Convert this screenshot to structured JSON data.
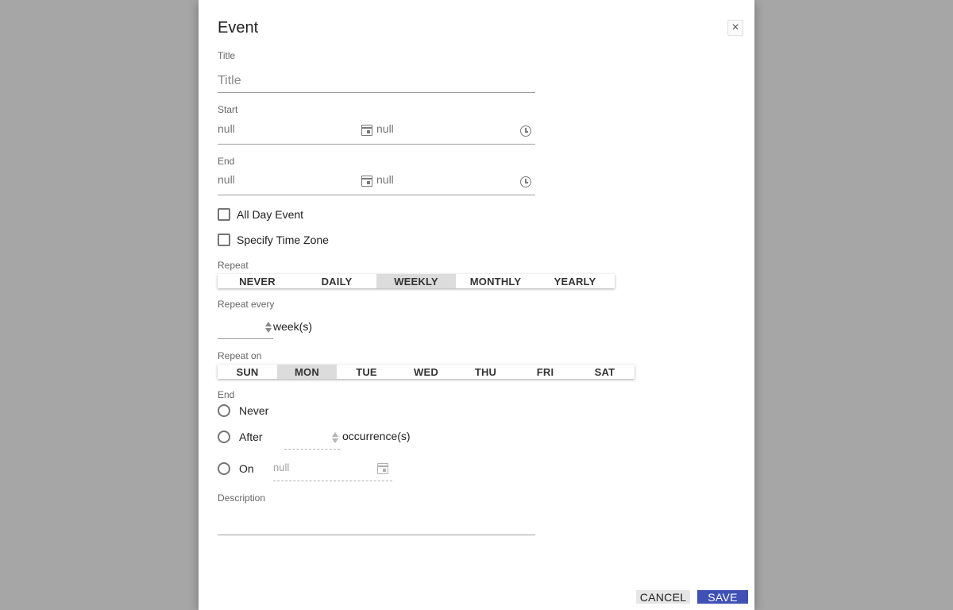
{
  "dialog": {
    "title": "Event",
    "close_glyph": "×"
  },
  "fields": {
    "title_label": "Title",
    "title_placeholder": "Title",
    "start_label": "Start",
    "start_date": "null",
    "start_time": "null",
    "end_label": "End",
    "end_date": "null",
    "end_time": "null",
    "all_day_label": "All Day Event",
    "time_zone_label": "Specify Time Zone"
  },
  "repeat": {
    "label": "Repeat",
    "options": [
      "NEVER",
      "DAILY",
      "WEEKLY",
      "MONTHLY",
      "YEARLY"
    ],
    "selected": "WEEKLY",
    "every_label": "Repeat every",
    "every_unit": "week(s)",
    "on_label": "Repeat on",
    "days": [
      "SUN",
      "MON",
      "TUE",
      "WED",
      "THU",
      "FRI",
      "SAT"
    ],
    "selected_day": "MON"
  },
  "end_options": {
    "label": "End",
    "never_label": "Never",
    "after_label": "After",
    "after_unit": "occurrence(s)",
    "on_label": "On",
    "on_date": "null"
  },
  "description": {
    "label": "Description"
  },
  "actions": {
    "cancel_label": "CANCEL",
    "save_label": "SAVE"
  },
  "colors": {
    "accent": "#3f51b5",
    "overlay": "#a6a6a6",
    "segment_active": "#dcdcdc"
  }
}
